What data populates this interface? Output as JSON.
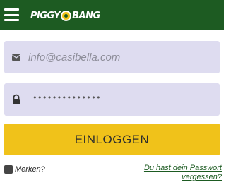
{
  "header": {
    "logo_part1": "PIGGY",
    "logo_part2": "BANG",
    "menu_icon": "hamburger-menu-icon",
    "logo_coin_icon": "coin-icon"
  },
  "login_form": {
    "email": {
      "icon": "envelope-icon",
      "placeholder": "info@casibella.com",
      "value": ""
    },
    "password": {
      "icon": "lock-icon",
      "masked_value": "••••••••••••••"
    },
    "login_button_label": "EINLOGGEN",
    "remember_label": "Merken?",
    "forgot_password_label": "Du hast dein Passwort vergessen?"
  },
  "colors": {
    "header_bg": "#1d5b22",
    "field_bg": "#dedcf0",
    "button_bg": "#f0c21a",
    "link": "#1d5b22"
  }
}
